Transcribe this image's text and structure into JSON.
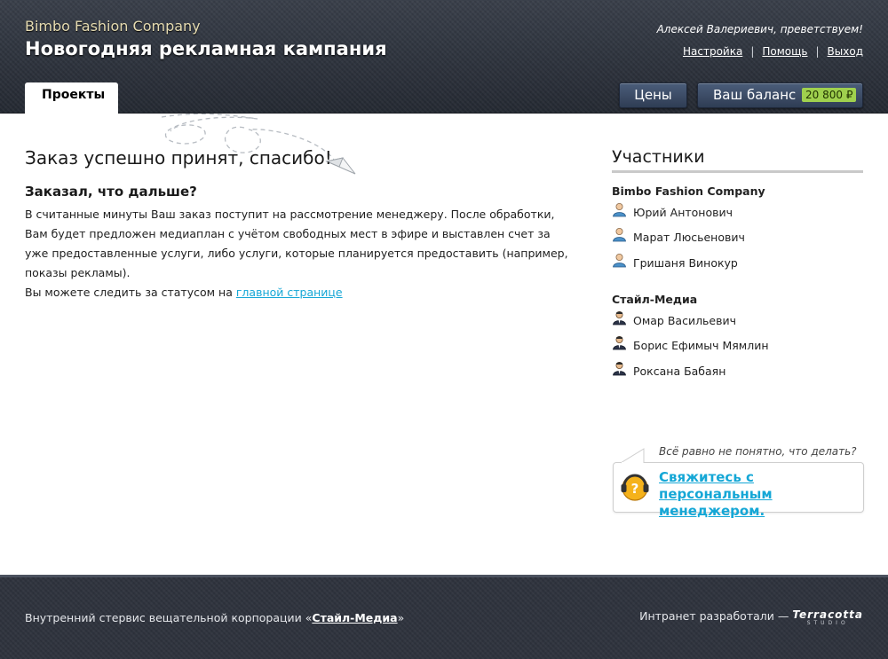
{
  "header": {
    "company": "Bimbo Fashion Company",
    "campaign": "Новогодняя рекламная кампания",
    "greeting": "Алексей Валериевич, преветствуем!",
    "links": {
      "settings": "Настройка",
      "help": "Помощь",
      "logout": "Выход",
      "separator": "|"
    },
    "tab_projects": "Проекты",
    "prices_button": "Цены",
    "balance_label": "Ваш баланс",
    "balance_value": "20 800 ₽"
  },
  "main": {
    "title": "Заказ успешно принят, спасибо!",
    "subtitle": "Заказал, что дальше?",
    "paragraph": "В считанные минуты Ваш заказ поступит на рассмотрение менеджеру. После обработки, Вам будет предложен медиаплан с учётом свободных мест в эфире и выставлен счет за уже предоставленные услуги, либо услуги, которые планируется предоставить (например, показы рекламы).",
    "follow_text": "Вы можете следить за статусом на",
    "follow_link": "главной странице"
  },
  "sidebar": {
    "title": "Участники",
    "groups": [
      {
        "name": "Bimbo Fashion Company",
        "members": [
          "Юрий Антонович",
          "Марат Люсьенович",
          "Гришаня Винокур"
        ]
      },
      {
        "name": "Стайл-Медиа",
        "members": [
          "Омар Васильевич",
          "Борис Ефимыч Мямлин",
          "Роксана Бабаян"
        ]
      }
    ],
    "help_question": "Всё равно не понятно, что делать?",
    "help_link": "Свяжитесь с персональным менеджером.",
    "icons": {
      "client": "user-icon",
      "staff": "suited-user-icon",
      "help": "headset-help-icon"
    }
  },
  "footer": {
    "left_text": "Внутренний стервис вещательной корпорации «",
    "left_link": "Стайл-Медиа",
    "left_end": "»",
    "right_text": "Интранет разработали —",
    "logo_line1": "Terracotta",
    "logo_line2": "STUDIO"
  },
  "colors": {
    "accent_link": "#15a7d6",
    "balance_badge": "#9fd04e",
    "header_bg": "#2e3440"
  }
}
